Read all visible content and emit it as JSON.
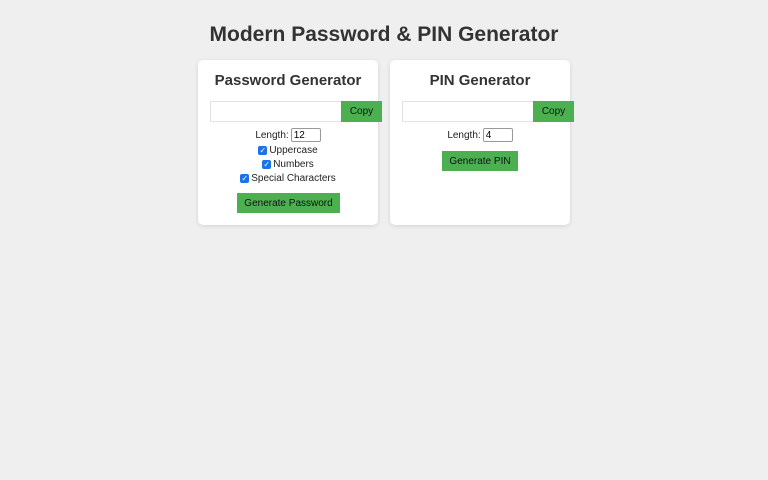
{
  "page": {
    "title": "Modern Password & PIN Generator"
  },
  "password_generator": {
    "title": "Password Generator",
    "output_value": "",
    "copy_label": "Copy",
    "length_label": "Length:",
    "length_value": "12",
    "options": [
      {
        "label": "Uppercase",
        "checked": true
      },
      {
        "label": "Numbers",
        "checked": true
      },
      {
        "label": "Special Characters",
        "checked": true
      }
    ],
    "generate_label": "Generate Password"
  },
  "pin_generator": {
    "title": "PIN Generator",
    "output_value": "",
    "copy_label": "Copy",
    "length_label": "Length:",
    "length_value": "4",
    "generate_label": "Generate PIN"
  },
  "colors": {
    "background": "#efefef",
    "card": "#ffffff",
    "accent_button": "#4caf50",
    "checkbox": "#1a73e8"
  }
}
